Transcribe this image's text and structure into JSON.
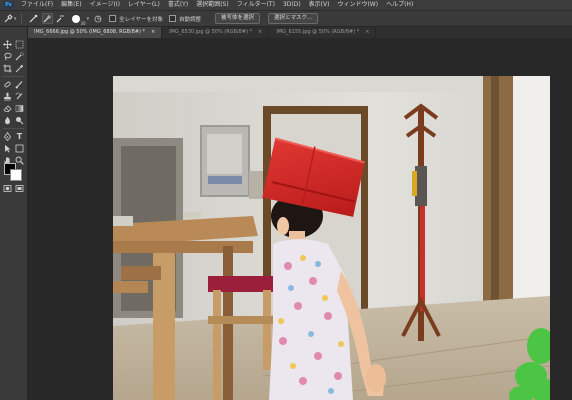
{
  "menubar": {
    "logo": "Ps",
    "items": [
      "ファイル(F)",
      "編集(E)",
      "イメージ(I)",
      "レイヤー(L)",
      "書式(Y)",
      "選択範囲(S)",
      "フィルター(T)",
      "3D(D)",
      "表示(V)",
      "ウィンドウ(W)",
      "ヘルプ(H)"
    ]
  },
  "options": {
    "brush_size": "30",
    "sample_all_layers_label": "全レイヤーを対象",
    "auto_enhance_label": "自動調整",
    "select_subject_label": "被写体を選択",
    "select_mask_label": "選択とマスク..."
  },
  "tabs": [
    {
      "label": "IMG_6666.jpg @ 50% (IMG_6808, RGB/8#) *",
      "close": "×",
      "active": true
    },
    {
      "label": "IMG_6530.jpg @ 50% (RGB/8#) *",
      "close": "×",
      "active": false
    },
    {
      "label": "IMG_6155.jpg @ 50% (RGB/8#) *",
      "close": "×",
      "active": false
    }
  ],
  "colors": {
    "foreground": "#000000",
    "background": "#ffffff",
    "hat": "#d42121"
  },
  "tools": [
    "move-icon",
    "marquee-icon",
    "lasso-icon",
    "quick-selection-icon",
    "crop-icon",
    "eyedropper-icon",
    "healing-brush-icon",
    "brush-icon",
    "clone-stamp-icon",
    "history-brush-icon",
    "eraser-icon",
    "gradient-icon",
    "blur-icon",
    "dodge-icon",
    "pen-icon",
    "type-icon",
    "path-selection-icon",
    "shape-icon",
    "hand-icon",
    "zoom-icon",
    "more-tools-icon",
    "quick-mask-icon",
    "screen-mode-icon"
  ]
}
